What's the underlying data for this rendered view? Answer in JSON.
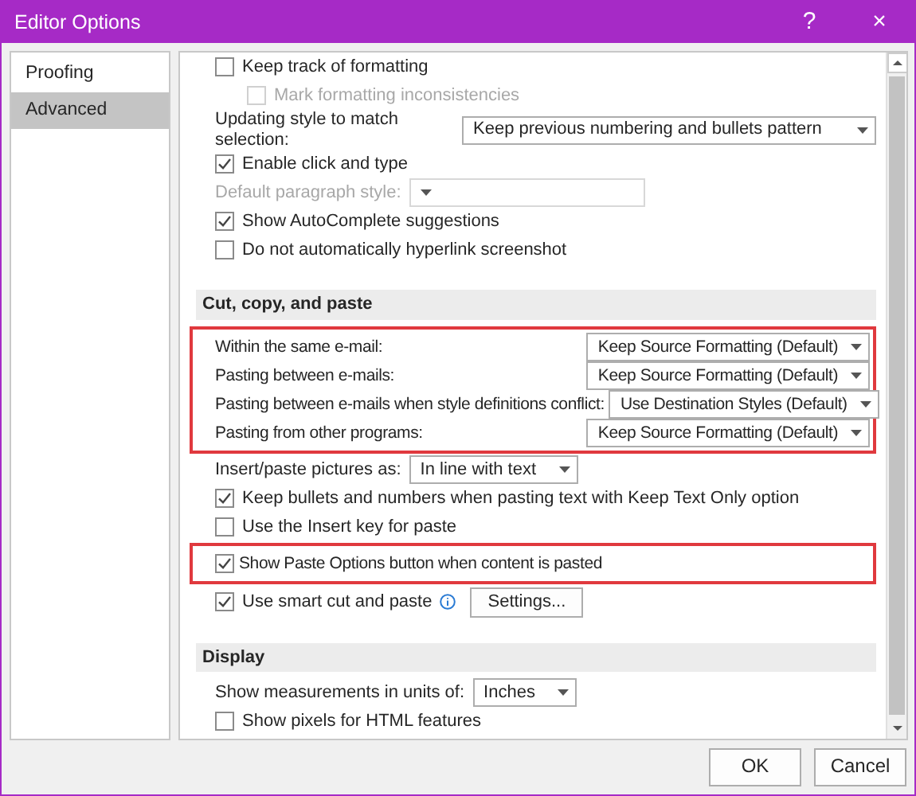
{
  "window": {
    "title": "Editor Options",
    "help": "?",
    "close": "×"
  },
  "sidebar": {
    "items": [
      {
        "label": "Proofing",
        "selected": false
      },
      {
        "label": "Advanced",
        "selected": true
      }
    ]
  },
  "sections": [
    {
      "items": [
        {
          "kind": "checkbox",
          "label": "Keep track of formatting",
          "checked": false,
          "disabled": false,
          "children": [
            {
              "kind": "checkbox",
              "label": "Mark formatting inconsistencies",
              "checked": false,
              "disabled": true
            }
          ]
        },
        {
          "kind": "select",
          "label": "Updating style to match selection:",
          "value": "Keep previous numbering and bullets pattern",
          "disabled": false
        },
        {
          "kind": "checkbox",
          "label": "Enable click and type",
          "checked": true,
          "disabled": false
        },
        {
          "kind": "select",
          "label": "Default paragraph style:",
          "disabled": true
        },
        {
          "kind": "checkbox",
          "label": "Show AutoComplete suggestions",
          "checked": true,
          "disabled": false
        },
        {
          "kind": "checkbox",
          "label": "Do not automatically hyperlink screenshot",
          "checked": false,
          "disabled": false
        }
      ]
    },
    {
      "title": "Cut, copy, and paste",
      "items": [
        {
          "kind": "select",
          "label": "Within the same e-mail:",
          "value": "Keep Source Formatting (Default)",
          "disabled": false,
          "highlighted": true
        },
        {
          "kind": "select",
          "label": "Pasting between e-mails:",
          "value": "Keep Source Formatting (Default)",
          "disabled": false,
          "highlighted": true
        },
        {
          "kind": "select",
          "label": "Pasting between e-mails when style definitions conflict:",
          "value": "Use Destination Styles (Default)",
          "disabled": false,
          "highlighted": true
        },
        {
          "kind": "select",
          "label": "Pasting from other programs:",
          "value": "Keep Source Formatting (Default)",
          "disabled": false,
          "highlighted": true
        },
        {
          "kind": "select",
          "label": "Insert/paste pictures as:",
          "value": "In line with text",
          "disabled": false,
          "highlighted": false
        },
        {
          "kind": "checkbox",
          "label": "Keep bullets and numbers when pasting text with Keep Text Only option",
          "checked": true,
          "disabled": false,
          "highlighted": false
        },
        {
          "kind": "checkbox",
          "label": "Use the Insert key for paste",
          "checked": false,
          "disabled": false,
          "highlighted": false
        },
        {
          "kind": "checkbox",
          "label": "Show Paste Options button when content is pasted",
          "checked": true,
          "disabled": false,
          "highlighted": true
        },
        {
          "kind": "checkbox",
          "label": "Use smart cut and paste",
          "checked": true,
          "disabled": false,
          "highlighted": false,
          "info": true,
          "button": "Settings..."
        }
      ]
    },
    {
      "title": "Display",
      "items": [
        {
          "kind": "select",
          "label": "Show measurements in units of:",
          "value": "Inches",
          "disabled": false
        },
        {
          "kind": "checkbox",
          "label": "Show pixels for HTML features",
          "checked": false,
          "disabled": false
        }
      ]
    }
  ],
  "buttons": [
    "OK",
    "Cancel"
  ]
}
